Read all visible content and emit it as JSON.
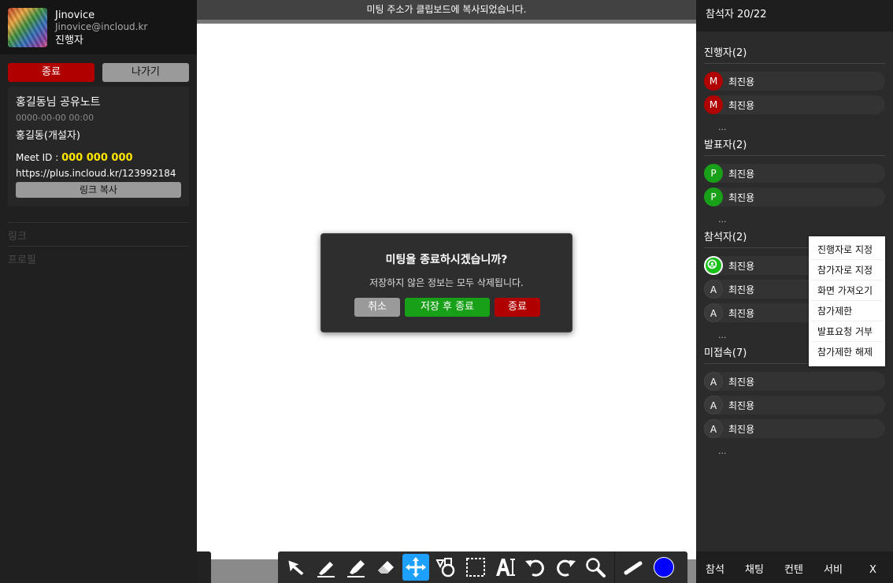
{
  "profile": {
    "name": "Jinovice",
    "email": "Jinovice@incloud.kr",
    "role": "진행자"
  },
  "buttons": {
    "end": "종료",
    "leave": "나가기",
    "copy_link": "링크 복사"
  },
  "note": {
    "title": "홍길동님 공유노트",
    "datetime": "0000-00-00 00:00",
    "owner": "홍길동(개설자)",
    "meet_id_label": "Meet ID : ",
    "meet_id": "000 000 000",
    "url": "https://plus.incloud.kr/123992184"
  },
  "left_menu": [
    "링크",
    "프로필"
  ],
  "toast": "미팅 주소가 클립보드에 복사되었습니다.",
  "modal": {
    "title": "미팅을 종료하시겠습니까?",
    "message": "저장하지 않은 정보는 모두 삭제됩니다.",
    "cancel": "취소",
    "save_end": "저장 후 종료",
    "end": "종료"
  },
  "toolbar": {
    "tools": [
      "pointer-icon",
      "pen-icon",
      "highlighter-icon",
      "eraser-icon",
      "move-icon",
      "shapes-icon",
      "select-icon",
      "text-icon",
      "undo-icon",
      "redo-icon",
      "zoom-icon",
      "line-width-icon"
    ],
    "active_tool": "move-icon",
    "current_color": "#0000ff"
  },
  "participants": {
    "header": "참석자 20/22",
    "sections": [
      {
        "label": "진행자(2)",
        "members": [
          {
            "initial": "M",
            "name": "최진용"
          },
          {
            "initial": "M",
            "name": "최진용"
          }
        ],
        "more": "..."
      },
      {
        "label": "발표자(2)",
        "members": [
          {
            "initial": "P",
            "name": "최진용"
          },
          {
            "initial": "P",
            "name": "최진용"
          }
        ],
        "more": "..."
      },
      {
        "label": "참석자(2)",
        "members": [
          {
            "initial": "",
            "name": "최진용"
          },
          {
            "initial": "A",
            "name": "최진용"
          },
          {
            "initial": "A",
            "name": "최진용"
          }
        ],
        "more": "..."
      },
      {
        "label": "미접속(7)",
        "members": [
          {
            "initial": "A",
            "name": "최진용"
          },
          {
            "initial": "A",
            "name": "최진용"
          },
          {
            "initial": "A",
            "name": "최진용"
          }
        ],
        "more": "..."
      }
    ]
  },
  "context_menu": [
    "진행자로 지정",
    "참가자로 지정",
    "화면 가져오기",
    "참가제한",
    "발표요청 거부",
    "참가제한 해제"
  ],
  "bottom_tabs": [
    "참석",
    "채팅",
    "컨텐",
    "서비",
    "X"
  ],
  "colors": {
    "danger": "#b00000",
    "success": "#18a018",
    "accent": "#1ea0ff",
    "meet_id": "#ffe600"
  }
}
